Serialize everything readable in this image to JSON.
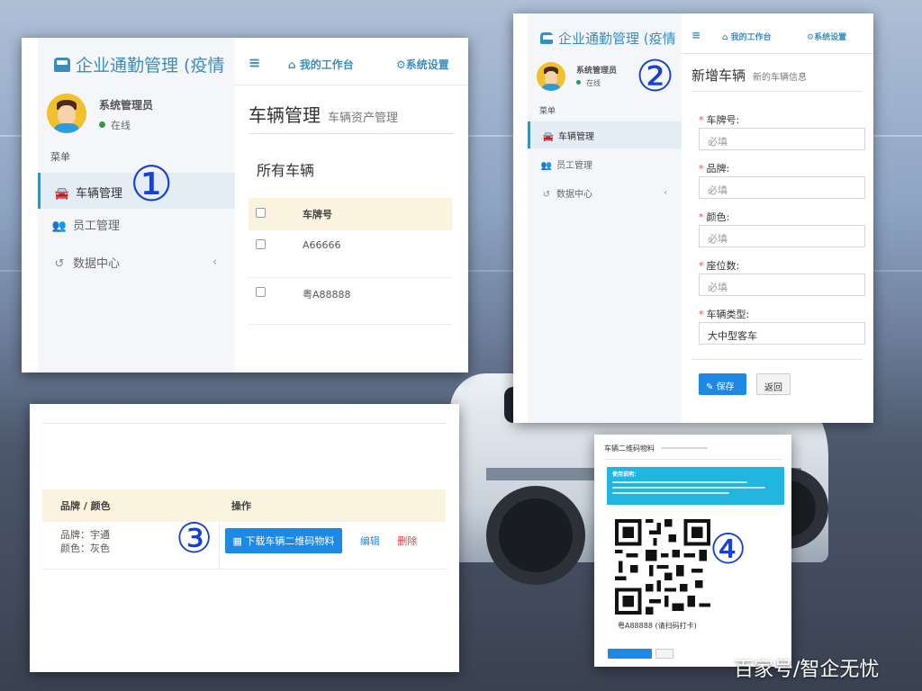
{
  "watermark": "百家号/智企无忧",
  "labels": {
    "n1": "①",
    "n2": "②",
    "n3": "③",
    "n4": "④"
  },
  "colors": {
    "primary": "#3c8dbc",
    "button": "#1e88e5",
    "danger": "#e53935",
    "online": "#2e9b3e",
    "table_header": "#fbf3dd"
  },
  "app": {
    "brand": "企业通勤管理 (疫情",
    "topbar": {
      "menu_icon": "≡",
      "workbench": "我的工作台",
      "settings": "系统设置"
    },
    "user": {
      "name": "系统管理员",
      "status": "在线"
    },
    "menu_header": "菜单",
    "nav": [
      {
        "label": "车辆管理",
        "icon": "car-icon",
        "active": true
      },
      {
        "label": "员工管理",
        "icon": "users-icon",
        "active": false
      },
      {
        "label": "数据中心",
        "icon": "history-icon",
        "active": false
      }
    ]
  },
  "panel1": {
    "title": "车辆管理",
    "subtitle": "车辆资产管理",
    "section_title": "所有车辆",
    "table": {
      "header": "车牌号",
      "rows": [
        "A66666",
        "粤A88888"
      ]
    }
  },
  "panel2": {
    "title": "新增车辆",
    "subtitle": "新的车辆信息",
    "fields": [
      {
        "label": "车牌号:",
        "placeholder": "必填",
        "value": ""
      },
      {
        "label": "品牌:",
        "placeholder": "必填",
        "value": ""
      },
      {
        "label": "颜色:",
        "placeholder": "必填",
        "value": ""
      },
      {
        "label": "座位数:",
        "placeholder": "必填",
        "value": ""
      },
      {
        "label": "车辆类型:",
        "placeholder": "",
        "value": "大中型客车"
      }
    ],
    "save_label": "保存",
    "back_label": "返回"
  },
  "panel3": {
    "header_brand_color": "品牌 / 颜色",
    "header_action": "操作",
    "row": {
      "brand": "品牌：宇通",
      "color": "颜色：灰色",
      "download_label": "下载车辆二维码物料",
      "edit_label": "编辑",
      "delete_label": "删除"
    }
  },
  "panel4": {
    "title": "车辆二维码物料",
    "notice_title": "使用说明：",
    "qr_caption": "粤A88888 (请扫码打卡)"
  }
}
